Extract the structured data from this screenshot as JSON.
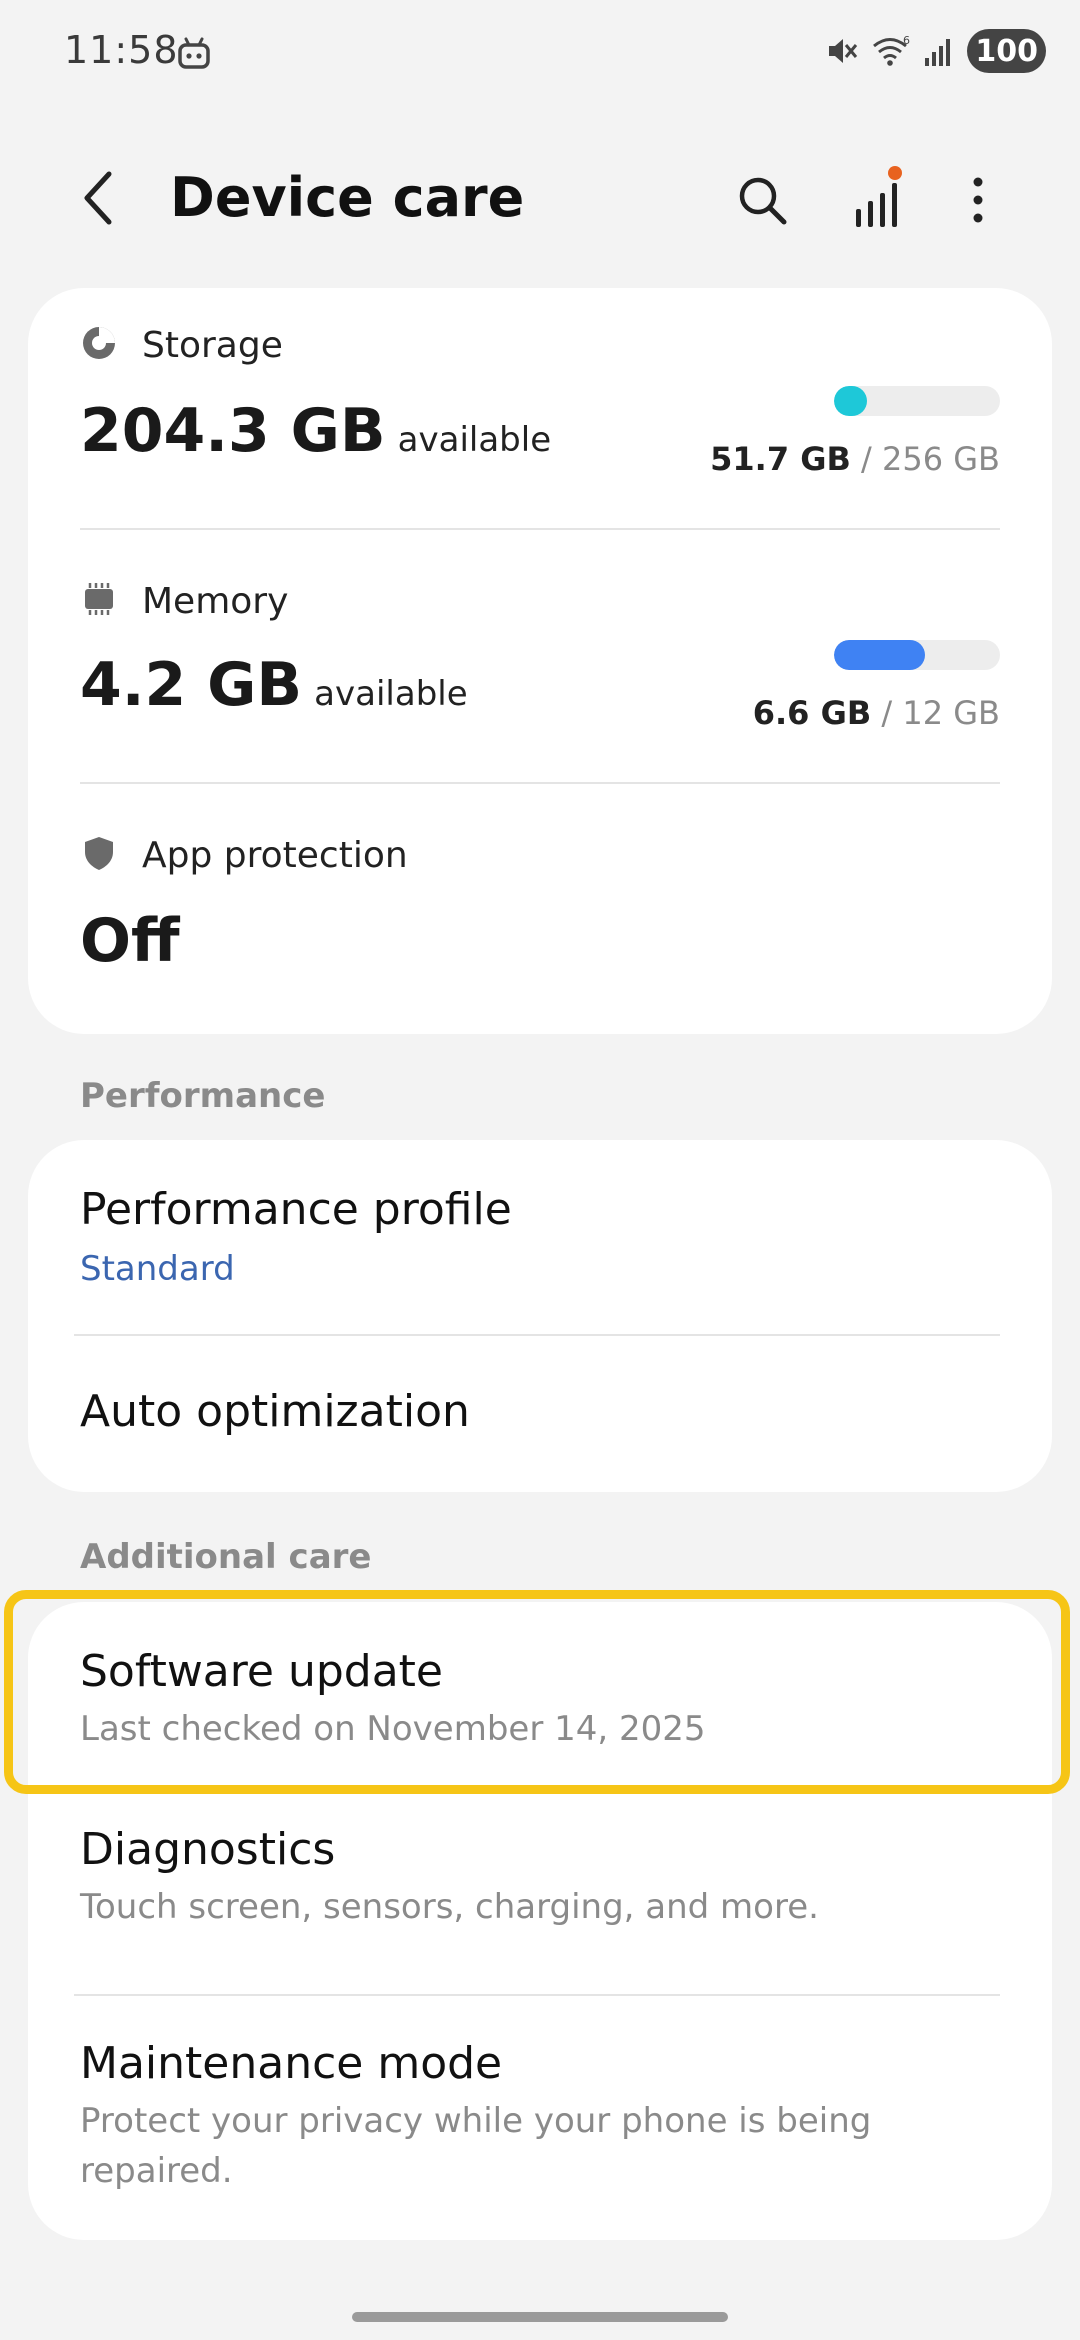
{
  "status_bar": {
    "time": "11:58",
    "battery": "100",
    "icons": [
      "robot-icon",
      "mute-icon",
      "wifi-icon",
      "signal-icon"
    ]
  },
  "app_bar": {
    "title": "Device care",
    "icons": [
      "back-arrow-icon",
      "search-icon",
      "bar-chart-icon",
      "more-options-icon"
    ],
    "notification_dot_color": "#e8621f"
  },
  "storage": {
    "label": "Storage",
    "value": "204.3 GB",
    "suffix": "available",
    "used": "51.7 GB",
    "separator": " / ",
    "total": "256 GB",
    "used_fraction": 0.2,
    "bar_color": "#1ec8d8"
  },
  "memory": {
    "label": "Memory",
    "value": "4.2 GB",
    "suffix": "available",
    "used": "6.6 GB",
    "separator": " / ",
    "total": "12 GB",
    "used_fraction": 0.55,
    "bar_color": "#3f82f3"
  },
  "app_protection": {
    "label": "App protection",
    "value": "Off"
  },
  "performance": {
    "header": "Performance",
    "profile_title": "Performance profile",
    "profile_value": "Standard",
    "auto_optimization": "Auto optimization"
  },
  "additional_care": {
    "header": "Additional care",
    "software_update": {
      "title": "Software update",
      "subtitle": "Last checked on November 14, 2025"
    },
    "diagnostics": {
      "title": "Diagnostics",
      "subtitle": "Touch screen, sensors, charging, and more."
    },
    "maintenance_mode": {
      "title": "Maintenance mode",
      "subtitle": "Protect your privacy while your phone is being repaired."
    }
  },
  "colors": {
    "background": "#f3f3f3",
    "card": "#ffffff",
    "accent_link": "#3b66b0",
    "highlight_border": "#f6c516"
  }
}
